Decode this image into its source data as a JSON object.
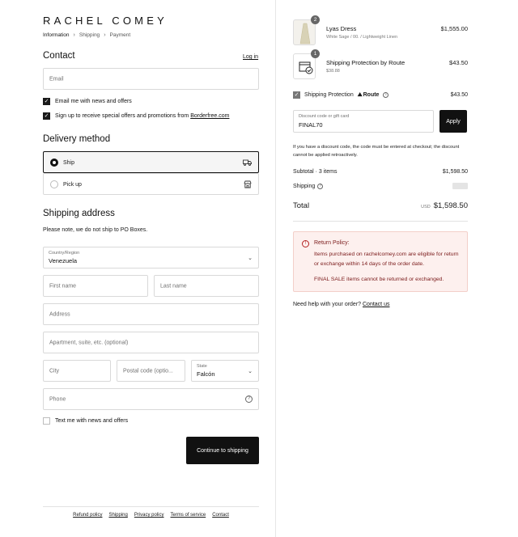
{
  "brand": "RACHEL COMEY",
  "breadcrumbs": [
    "Information",
    "Shipping",
    "Payment"
  ],
  "contact": {
    "title": "Contact",
    "login_link": "Log in",
    "email_placeholder": "Email",
    "email_news_label": "Email me with news and offers",
    "offers_label_prefix": "Sign up to receive special offers and promotions from ",
    "offers_label_link": "Borderfree.com"
  },
  "delivery": {
    "title": "Delivery method",
    "options": [
      {
        "label": "Ship",
        "selected": true,
        "icon": "truck-icon"
      },
      {
        "label": "Pick up",
        "selected": false,
        "icon": "store-icon"
      }
    ]
  },
  "shipping_address": {
    "title": "Shipping address",
    "note": "Please note, we do not ship to PO Boxes.",
    "country_label": "Country/Region",
    "country_value": "Venezuela",
    "first_name_placeholder": "First name",
    "last_name_placeholder": "Last name",
    "address_placeholder": "Address",
    "apartment_placeholder": "Apartment, suite, etc. (optional)",
    "city_placeholder": "City",
    "postal_placeholder": "Postal code (optio...",
    "state_label": "State",
    "state_value": "Falcón",
    "phone_placeholder": "Phone",
    "text_news_label": "Text me with news and offers",
    "continue_button": "Continue to shipping"
  },
  "footer_links": [
    "Refund policy",
    "Shipping",
    "Privacy policy",
    "Terms of service",
    "Contact"
  ],
  "order": {
    "items": [
      {
        "title": "Lyas Dress",
        "subtitle": "White Sage / 00. / Lightweight Linen",
        "price": "$1,555.00",
        "qty": "2"
      },
      {
        "title": "Shipping Protection by Route",
        "subtitle": "$38.88",
        "price": "$43.50",
        "qty": "1"
      }
    ],
    "protection": {
      "label": "Shipping Protection",
      "brand": "Route",
      "price": "$43.50"
    },
    "discount": {
      "label": "Discount code or gift card",
      "value": "FINAL70",
      "apply": "Apply"
    },
    "discount_note": "If you have a discount code, the code must be entered at checkout; the discount cannot be applied retroactively.",
    "subtotal_label": "Subtotal · 3 items",
    "subtotal_value": "$1,598.50",
    "shipping_label": "Shipping",
    "total_label": "Total",
    "total_currency": "USD",
    "total_value": "$1,598.50"
  },
  "return_policy": {
    "title": "Return Policy:",
    "line1": "Items purchased on rachelcomey.com are eligible for return or exchange within 14 days of the order date.",
    "line2": "FINAL SALE items cannot be returned or exchanged."
  },
  "help": {
    "text": "Need help with your order? ",
    "link": "Contact us"
  }
}
